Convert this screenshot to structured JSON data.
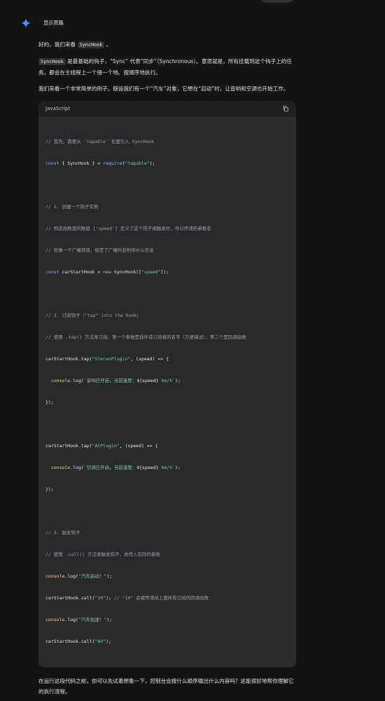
{
  "thinking": {
    "label": "显示思路"
  },
  "intro": {
    "p1_before": "好的，我们来看 ",
    "p1_code": "SyncHook",
    "p1_after": " 。",
    "p2_code": "SyncHook",
    "p2_after": " 是最基础的钩子，“Sync” 代表“同步”（Synchronous）。意思就是，所有挂载到这个钩子上的任务，都会在主线程上一个接一个地、按顺序地执行。",
    "p3": "我们来看一个非常简单的例子。假设我们有一个“汽车”对象，它想在“启动”时，让音响和空调也开始工作。"
  },
  "code_block": {
    "language": "JavaScript",
    "lines": [
      "// 首先，需要从 'tapable' 包里引入 SyncHook",
      "const { SyncHook } = require(\"tapable\");",
      "",
      "// 1. 创建一个钩子实例",
      "// 构造函数里的数组 ['speed'] 定义了这个钩子被触发时，可以传递的参数名",
      "// 就像一个广播频道，规定了广播时会附带什么信息",
      "const carStartHook = new SyncHook([\"speed\"]);",
      "",
      "// 2. 订阅钩子（\"tap\" into the hook）",
      "// 使用 .tap() 方法来订阅，第一个参数是插件或订阅者的名字（方便调试），第二个是回调函数",
      "carStartHook.tap(\"StereoPlugin\", (speed) => {",
      "  console.log(`音响已开启，当前速度：${speed} km/h`);",
      "});",
      "",
      "carStartHook.tap(\"ACPlugin\", (speed) => {",
      "  console.log(`空调已开启，当前速度：${speed} km/h`);",
      "});",
      "",
      "// 3. 触发钩子",
      "// 使用 .call() 方法来触发钩子，并传入实际的参数",
      "console.log(\"汽车启动！\");",
      "carStartHook.call(\"10\"); // \"10\" 会被传递给上面所有订阅的回调函数",
      "console.log(\"汽车加速！\");",
      "carStartHook.call(\"60\");"
    ]
  },
  "outro": "在运行这段代码之前，你可以先试着想象一下，控制台会按什么顺序输出什么内容吗？这能很好地帮你理解它的执行流程。",
  "colors": {
    "background": "#131314",
    "code_bg": "#282a2c",
    "header_bg": "#1e1f20",
    "gemini_blue": "#4c8df6"
  },
  "icons": {
    "thinking": "gemini-spark-icon",
    "copy": "copy-icon"
  }
}
